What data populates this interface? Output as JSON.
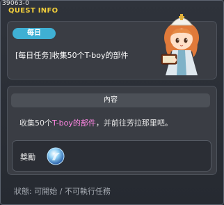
{
  "quest_id": "39063-0",
  "window_title": "QUEST INFO",
  "badge": "每日",
  "quest_name": "[每日任务]收集50个T-boy的部件",
  "content": {
    "header": "內容",
    "text_before": "收集50个",
    "text_highlight": "T-boy的部件",
    "text_after": "，并前往芳拉那里吧。"
  },
  "reward": {
    "label": "獎勵",
    "icon": "crystal-orb-icon"
  },
  "status_text": "狀態: 可開始 / 不可執行任務",
  "colors": {
    "title": "#f3cf3a",
    "badge": "#3fb0d4",
    "highlight": "#ff86e3"
  }
}
